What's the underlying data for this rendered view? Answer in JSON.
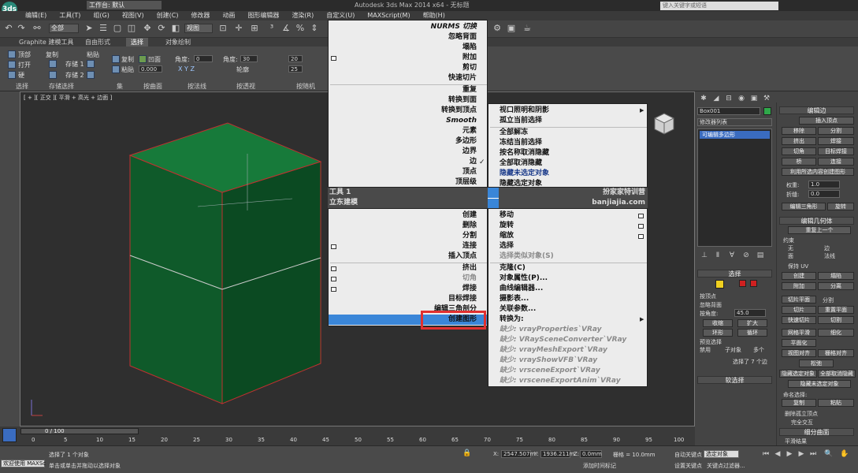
{
  "titlebar": {
    "logo": "3ds",
    "workspace_label": "工作台: 默认",
    "app_title": "Autodesk 3ds Max 2014 x64 - 无标题",
    "search_placeholder": "键入关键字或短语"
  },
  "menubar": [
    "编辑(E)",
    "工具(T)",
    "组(G)",
    "视图(V)",
    "创建(C)",
    "修改器",
    "动画",
    "图形编辑器",
    "渲染(R)",
    "自定义(U)",
    "MAXScript(M)",
    "帮助(H)"
  ],
  "toolbar": {
    "selection_filter": "全部",
    "reference_coord": "视图"
  },
  "ribbon": {
    "tabs": [
      "Graphite 建模工具",
      "自由形式",
      "选择",
      "对象绘制"
    ],
    "active_tab": "选择",
    "top_label": "顶部",
    "open_label": "打开",
    "hard_label": "硬",
    "copy_label": "复制",
    "paste_label": "粘贴",
    "store1": "存储 1",
    "store2": "存储 2",
    "copy2": "复制",
    "paste2": "粘贴",
    "convex_label": "凹面",
    "angle_label": "角度:",
    "angle_value": "0",
    "angle2_label": "角度:",
    "angle2_value": "30",
    "value_field": "0.000",
    "contour_label": "轮廓",
    "num1": "20",
    "num2": "25",
    "sections": [
      "选择",
      "存储选择",
      "集",
      "按曲面",
      "按法线",
      "按透视",
      "按随机"
    ]
  },
  "viewport": {
    "label": "[ + ][ 正交 ][ 平滑 + 高光 + 边面 ]"
  },
  "quad_menu": {
    "left_top": [
      "NURMS 切换",
      "忽略背面",
      "塌陷",
      "附加",
      "剪切",
      "快速切片",
      "重复",
      "转换到面",
      "转换到顶点",
      "Smooth",
      "元素",
      "多边形",
      "边界",
      "边",
      "顶点",
      "顶层级"
    ],
    "left_head": "工具 1",
    "left_head2": "立东建模",
    "left_bottom": [
      "创建",
      "删除",
      "分割",
      "连接",
      "插入顶点",
      "挤出",
      "切角",
      "焊接",
      "目标焊接",
      "编辑三角剖分",
      "创建图形"
    ],
    "right_top": [
      "视口照明和阴影",
      "孤立当前选择",
      "全部解冻",
      "冻结当前选择",
      "按名称取消隐藏",
      "全部取消隐藏",
      "隐藏未选定对象",
      "隐藏选定对象"
    ],
    "right_head": "扮家家特训营",
    "right_head2": "banjiajia.com",
    "right_bottom": [
      "移动",
      "旋转",
      "缩放",
      "选择",
      "选择类似对象(S)",
      "克隆(C)",
      "对象属性(P)...",
      "曲线编辑器...",
      "摄影表...",
      "关联参数...",
      "转换为:",
      "缺少: vrayProperties`VRay",
      "缺少: VRaySceneConverter`VRay",
      "缺少: vrayMeshExport`VRay",
      "缺少: vrayShowVFB`VRay",
      "缺少: vrsceneExport`VRay",
      "缺少: vrsceneExportAnim`VRay"
    ],
    "highlight_color": "#e03030"
  },
  "command_panel": {
    "object_name": "Box001",
    "modifier_list": "修改器列表",
    "stack_item": "可编辑多边形",
    "select_title": "选择",
    "by_vertex": "按顶点",
    "ignore_back": "忽略背面",
    "by_angle": "按角度:",
    "by_angle_value": "45.0",
    "shrink": "收缩",
    "grow": "扩大",
    "ring": "环形",
    "loop": "循环",
    "preview": "预览选择",
    "disabled": "禁用",
    "sub_obj": "子对象",
    "multi": "多个",
    "status": "选择了 7 个边",
    "soft_select": "软选择"
  },
  "rollout": {
    "edit_edges_title": "编辑边",
    "insert_vertex": "插入顶点",
    "remove": "移除",
    "split": "分割",
    "extrude": "挤出",
    "weld": "焊接",
    "chamfer": "切角",
    "target_weld": "目标焊接",
    "bridge": "桥",
    "connect": "连接",
    "create_shape": "利用所选内容创建图形",
    "weight": "权重:",
    "weight_value": "1.0",
    "crease": "折缝:",
    "crease_value": "0.0",
    "edit_tri": "编辑三角形",
    "turn": "旋转",
    "edit_geo_title": "编辑几何体",
    "repeat_last": "重复上一个",
    "constraints": "约束",
    "none": "无",
    "edge": "边",
    "face": "面",
    "normal": "法线",
    "preserve_uv": "保持 UV",
    "create": "创建",
    "collapse": "塌陷",
    "attach": "附加",
    "detach": "分离",
    "slice_plane": "切片平面",
    "split2": "分割",
    "slice": "切片",
    "reset_plane": "重置平面",
    "quickslice": "快速切片",
    "cut": "切割",
    "meshsmooth": "网格平滑",
    "tessellate": "细化",
    "planarize": "平面化",
    "view_align": "视图对齐",
    "grid_align": "栅格对齐",
    "relax": "松弛",
    "hide_sel": "隐藏选定对象",
    "unhide_all": "全部取消隐藏",
    "hide_unsel": "隐藏未选定对象",
    "named_sel": "命名选择:",
    "copy": "复制",
    "paste": "粘贴",
    "del_isolated": "删除孤立顶点",
    "full_interact": "完全交互",
    "subdiv_title": "细分曲面",
    "smooth_result": "平滑结果"
  },
  "timeline": {
    "frame": "0 / 100",
    "ticks": [
      "0",
      "5",
      "10",
      "15",
      "20",
      "25",
      "30",
      "35",
      "40",
      "45",
      "50",
      "55",
      "60",
      "65",
      "70",
      "75",
      "80",
      "85",
      "90",
      "95",
      "100"
    ]
  },
  "status": {
    "welcome": "欢迎使用 MAXSc",
    "selected": "选择了 1 个对象",
    "hint": "单击或单击并拖动以选择对象",
    "x": "2547.507m",
    "y": "1936.211m",
    "z": "0.0mm",
    "grid": "栅格 = 10.0mm",
    "autokey": "自动关键点",
    "selected_obj": "选定对象",
    "set_key": "设置关键点",
    "key_filter": "关键点过滤器...",
    "add_time_tag": "添加时间标记"
  }
}
